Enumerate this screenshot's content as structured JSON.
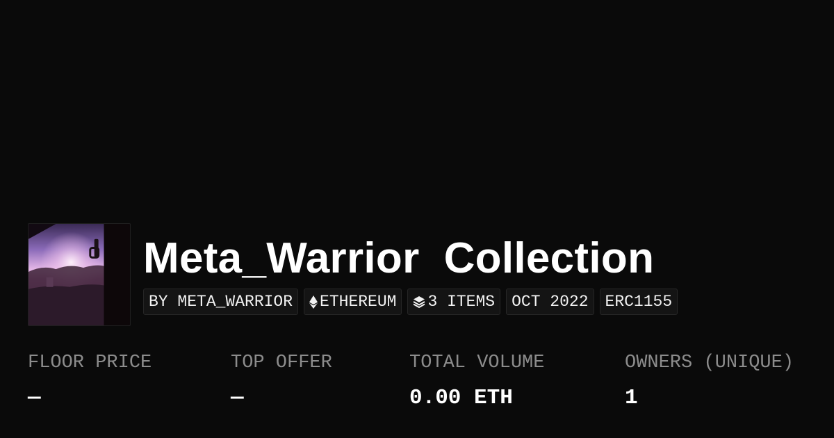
{
  "collection": {
    "title": "Meta_Warrior  Collection",
    "avatar_icon": "collection-avatar-sunset-image"
  },
  "badges": [
    {
      "label": "BY META_WARRIOR",
      "icon": ""
    },
    {
      "label": "ETHEREUM",
      "icon": "ethereum-icon"
    },
    {
      "label": "3 ITEMS",
      "icon": "layers-icon"
    },
    {
      "label": "OCT 2022",
      "icon": ""
    },
    {
      "label": "ERC1155",
      "icon": ""
    }
  ],
  "stats": [
    {
      "label": "FLOOR PRICE",
      "value": "—"
    },
    {
      "label": "TOP OFFER",
      "value": "—"
    },
    {
      "label": "TOTAL VOLUME",
      "value": "0.00 ETH"
    },
    {
      "label": "OWNERS (UNIQUE)",
      "value": "1"
    }
  ],
  "colors": {
    "background": "#0a0a0a",
    "text": "#ffffff",
    "muted": "#8c8c8c",
    "badge_bg": "#141414"
  }
}
